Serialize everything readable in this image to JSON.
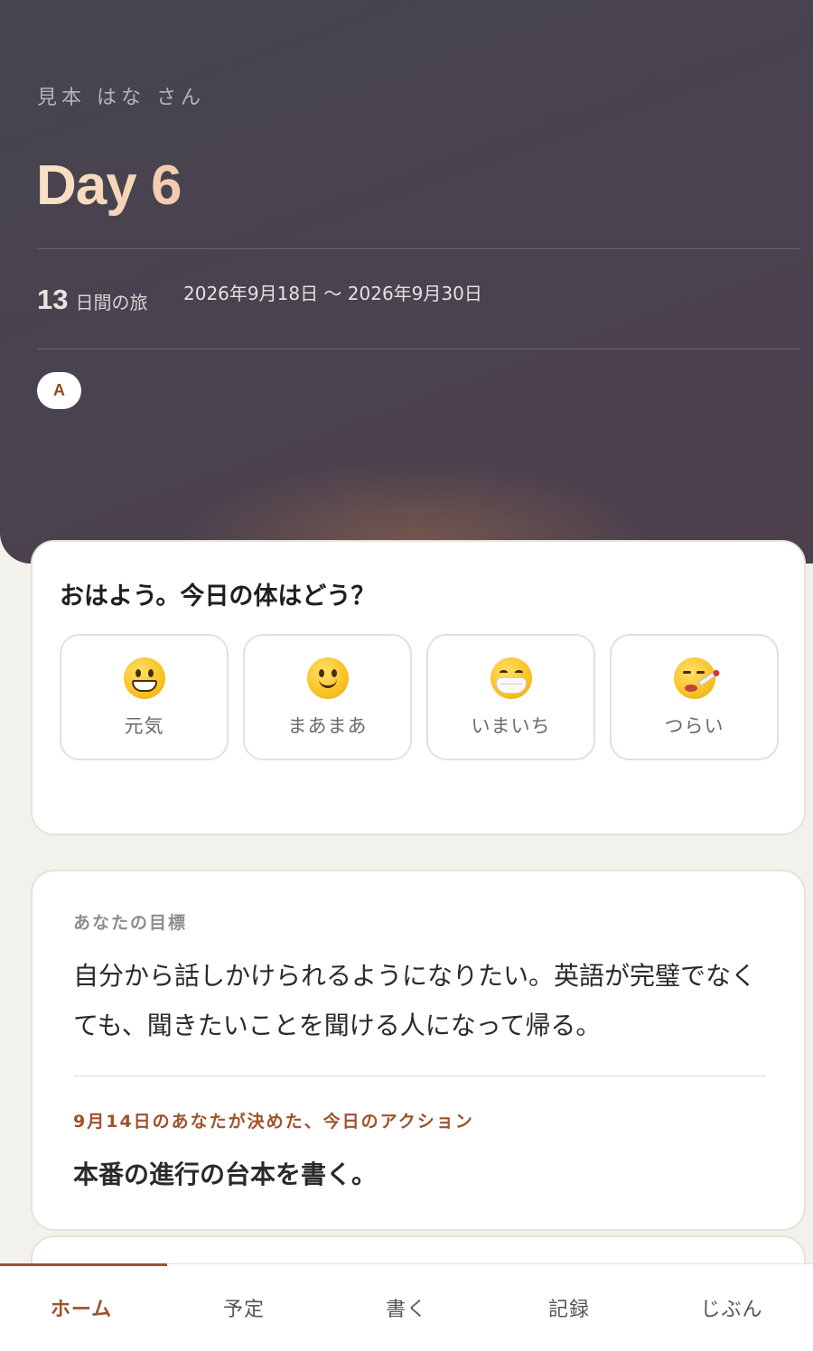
{
  "header": {
    "user_name": "見本 はな さん",
    "day_label": "Day 6",
    "trip_days": "13",
    "trip_days_unit": "日間の旅",
    "trip_dates": "2026年9月18日 〜 2026年9月30日",
    "avatar_letter": "A"
  },
  "mood": {
    "question": "おはよう。今日の体はどう？",
    "options": [
      {
        "label": "元気",
        "icon": "grinning-face-icon"
      },
      {
        "label": "まあまあ",
        "icon": "slightly-smiling-face-icon"
      },
      {
        "label": "いまいち",
        "icon": "face-with-mask-icon"
      },
      {
        "label": "つらい",
        "icon": "face-with-thermometer-icon"
      }
    ]
  },
  "goal": {
    "label": "あなたの目標",
    "text": "自分から話しかけられるようになりたい。英語が完璧でなくても、聞きたいことを聞ける人になって帰る。",
    "action_label": "9月14日のあなたが決めた、今日のアクション",
    "action_text": "本番の進行の台本を書く。"
  },
  "nav": {
    "tabs": [
      {
        "label": "ホーム",
        "active": true
      },
      {
        "label": "予定",
        "active": false
      },
      {
        "label": "書く",
        "active": false
      },
      {
        "label": "記録",
        "active": false
      },
      {
        "label": "じぶん",
        "active": false
      }
    ]
  },
  "colors": {
    "accent": "#a0522d",
    "header_bg": "#47434f",
    "page_bg": "#f3f1ec"
  }
}
